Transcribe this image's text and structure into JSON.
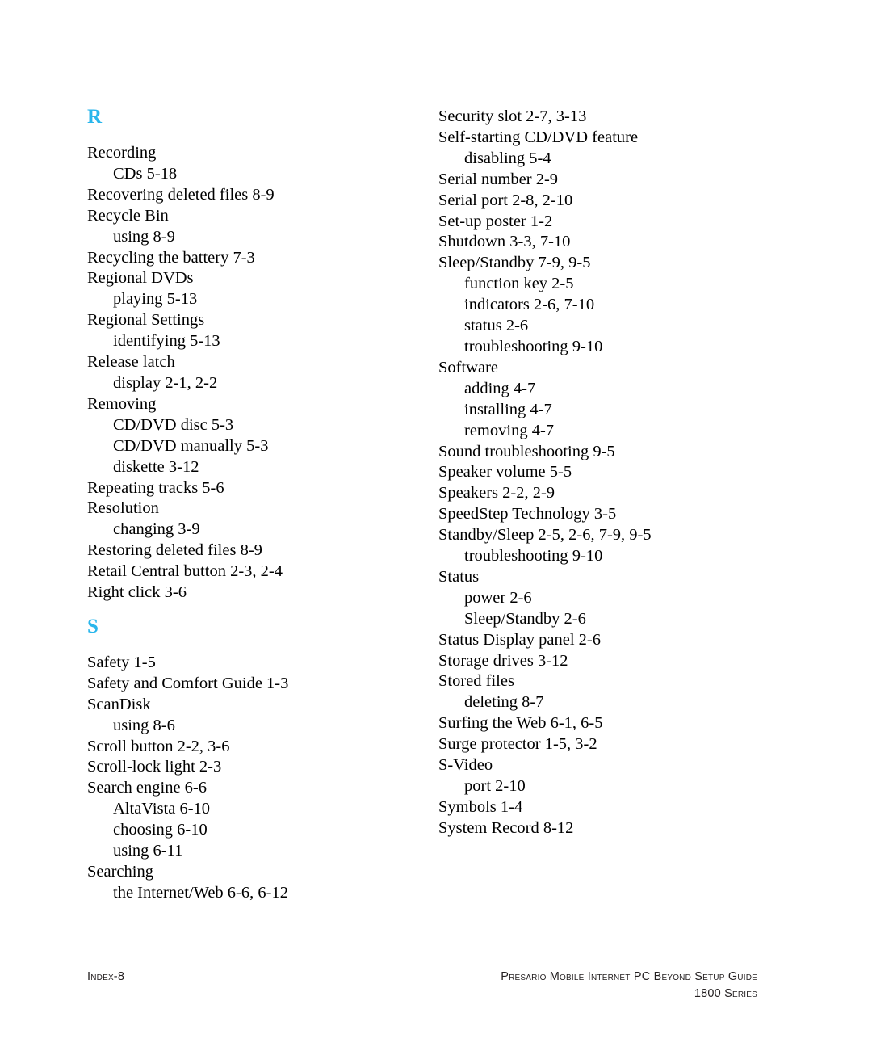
{
  "page": {
    "type": "index",
    "accent_color": "#29b6ec",
    "text_color": "#000000",
    "background_color": "#ffffff"
  },
  "columns": {
    "left": {
      "sections": [
        {
          "letter": "R",
          "entries": [
            {
              "level": 1,
              "text": "Recording"
            },
            {
              "level": 2,
              "text": "CDs 5-18"
            },
            {
              "level": 1,
              "text": "Recovering deleted files 8-9"
            },
            {
              "level": 1,
              "text": "Recycle Bin"
            },
            {
              "level": 2,
              "text": "using 8-9"
            },
            {
              "level": 1,
              "text": "Recycling the battery 7-3"
            },
            {
              "level": 1,
              "text": "Regional DVDs"
            },
            {
              "level": 2,
              "text": "playing 5-13"
            },
            {
              "level": 1,
              "text": "Regional Settings"
            },
            {
              "level": 2,
              "text": "identifying 5-13"
            },
            {
              "level": 1,
              "text": "Release latch"
            },
            {
              "level": 2,
              "text": "display 2-1, 2-2"
            },
            {
              "level": 1,
              "text": "Removing"
            },
            {
              "level": 2,
              "text": "CD/DVD disc 5-3"
            },
            {
              "level": 2,
              "text": "CD/DVD manually 5-3"
            },
            {
              "level": 2,
              "text": "diskette 3-12"
            },
            {
              "level": 1,
              "text": "Repeating tracks 5-6"
            },
            {
              "level": 1,
              "text": "Resolution"
            },
            {
              "level": 2,
              "text": "changing 3-9"
            },
            {
              "level": 1,
              "text": "Restoring deleted files 8-9"
            },
            {
              "level": 1,
              "text": "Retail Central button 2-3, 2-4"
            },
            {
              "level": 1,
              "text": "Right click 3-6"
            }
          ]
        },
        {
          "letter": "S",
          "entries": [
            {
              "level": 1,
              "text": "Safety 1-5"
            },
            {
              "level": 1,
              "text": "Safety and Comfort Guide 1-3"
            },
            {
              "level": 1,
              "text": "ScanDisk"
            },
            {
              "level": 2,
              "text": "using 8-6"
            },
            {
              "level": 1,
              "text": "Scroll button 2-2, 3-6"
            },
            {
              "level": 1,
              "text": "Scroll-lock light 2-3"
            },
            {
              "level": 1,
              "text": "Search engine 6-6"
            },
            {
              "level": 2,
              "text": "AltaVista 6-10"
            },
            {
              "level": 2,
              "text": "choosing 6-10"
            },
            {
              "level": 2,
              "text": "using 6-11"
            },
            {
              "level": 1,
              "text": "Searching"
            },
            {
              "level": 2,
              "text": "the Internet/Web 6-6, 6-12"
            }
          ]
        }
      ]
    },
    "right": {
      "sections": [
        {
          "letter": "",
          "entries": [
            {
              "level": 1,
              "text": "Security slot 2-7, 3-13"
            },
            {
              "level": 1,
              "text": "Self-starting CD/DVD feature"
            },
            {
              "level": 2,
              "text": "disabling 5-4"
            },
            {
              "level": 1,
              "text": "Serial number 2-9"
            },
            {
              "level": 1,
              "text": "Serial port 2-8, 2-10"
            },
            {
              "level": 1,
              "text": "Set-up poster 1-2"
            },
            {
              "level": 1,
              "text": "Shutdown 3-3, 7-10"
            },
            {
              "level": 1,
              "text": "Sleep/Standby 7-9, 9-5"
            },
            {
              "level": 2,
              "text": "function key 2-5"
            },
            {
              "level": 2,
              "text": "indicators 2-6, 7-10"
            },
            {
              "level": 2,
              "text": "status 2-6"
            },
            {
              "level": 2,
              "text": "troubleshooting 9-10"
            },
            {
              "level": 1,
              "text": "Software"
            },
            {
              "level": 2,
              "text": "adding 4-7"
            },
            {
              "level": 2,
              "text": "installing 4-7"
            },
            {
              "level": 2,
              "text": "removing 4-7"
            },
            {
              "level": 1,
              "text": "Sound troubleshooting 9-5"
            },
            {
              "level": 1,
              "text": "Speaker volume 5-5"
            },
            {
              "level": 1,
              "text": "Speakers 2-2, 2-9"
            },
            {
              "level": 1,
              "text": "SpeedStep Technology 3-5"
            },
            {
              "level": 1,
              "text": "Standby/Sleep 2-5, 2-6, 7-9, 9-5"
            },
            {
              "level": 2,
              "text": "troubleshooting 9-10"
            },
            {
              "level": 1,
              "text": "Status"
            },
            {
              "level": 2,
              "text": "power 2-6"
            },
            {
              "level": 2,
              "text": "Sleep/Standby 2-6"
            },
            {
              "level": 1,
              "text": "Status Display panel 2-6"
            },
            {
              "level": 1,
              "text": "Storage drives 3-12"
            },
            {
              "level": 1,
              "text": "Stored files"
            },
            {
              "level": 2,
              "text": "deleting 8-7"
            },
            {
              "level": 1,
              "text": "Surfing the Web 6-1, 6-5"
            },
            {
              "level": 1,
              "text": "Surge protector 1-5, 3-2"
            },
            {
              "level": 1,
              "text": "S-Video"
            },
            {
              "level": 2,
              "text": "port 2-10"
            },
            {
              "level": 1,
              "text": "Symbols 1-4"
            },
            {
              "level": 1,
              "text": "System Record 8-12"
            }
          ]
        }
      ]
    }
  },
  "footer": {
    "page_label": "Index-8",
    "guide_title": "Presario Mobile Internet PC Beyond Setup Guide",
    "series": "1800 Series"
  }
}
